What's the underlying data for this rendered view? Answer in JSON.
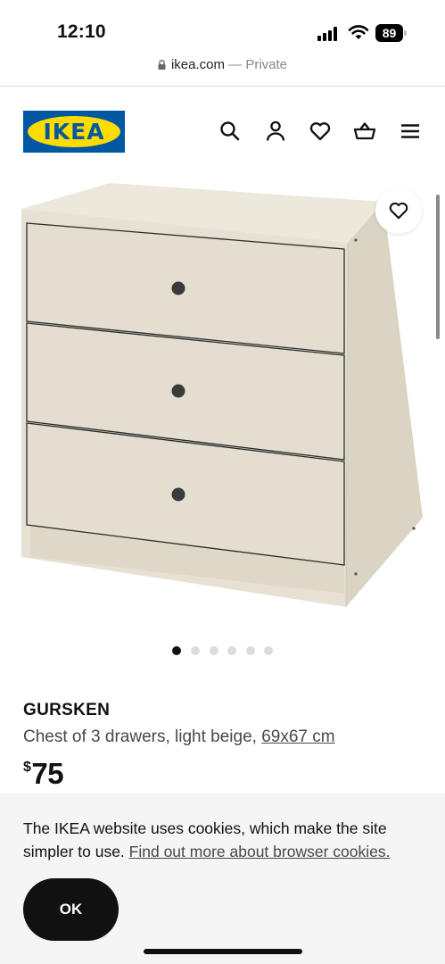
{
  "status_bar": {
    "time": "12:10",
    "battery": "89",
    "icons": [
      "signal-icon",
      "wifi-icon",
      "battery-icon"
    ]
  },
  "browser": {
    "url": "ikea.com",
    "separator": "—",
    "mode": "Private"
  },
  "header": {
    "logo_text": "IKEA",
    "icons": [
      "search-icon",
      "account-icon",
      "favourites-icon",
      "cart-icon",
      "menu-icon"
    ]
  },
  "gallery": {
    "image_count": 6,
    "active_index": 0
  },
  "product": {
    "name": "GURSKEN",
    "description": "Chest of 3 drawers, light beige,",
    "size_link": "69x67 cm",
    "currency": "$",
    "price": "75"
  },
  "cookie_banner": {
    "text": "The IKEA website uses cookies, which make the site simpler to use.",
    "link": "Find out more about browser cookies.",
    "ok_label": "OK"
  },
  "colors": {
    "ikea_blue": "#0058a3",
    "ikea_yellow": "#ffdb00",
    "dresser_beige": "#e6e1d3"
  }
}
